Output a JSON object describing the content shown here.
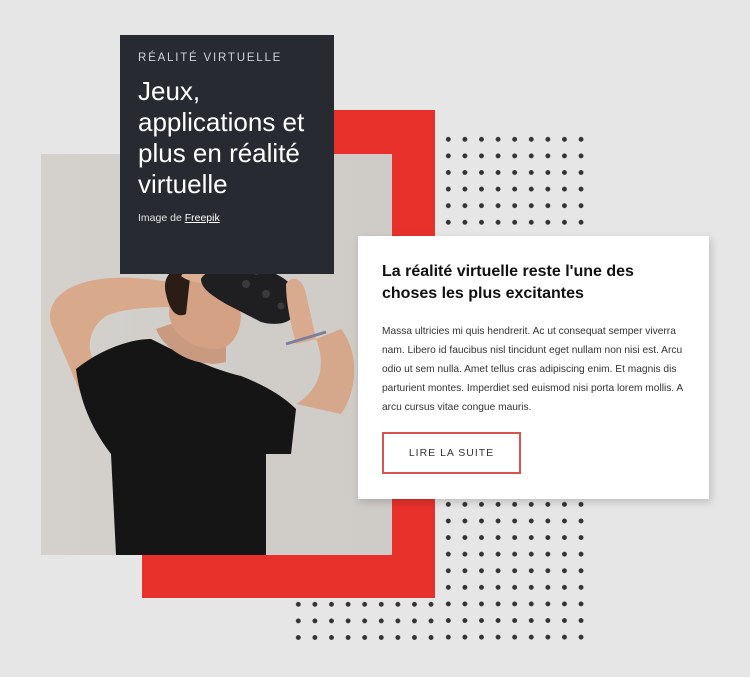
{
  "hero": {
    "eyebrow": "RÉALITÉ VIRTUELLE",
    "title": "Jeux, applications et plus en réalité virtuelle",
    "credit_prefix": "Image de ",
    "credit_link": "Freepik",
    "photo_subject": "man wearing VR headset in black t-shirt"
  },
  "card": {
    "heading": "La réalité virtuelle reste l'une des choses les plus excitantes",
    "body": "Massa ultricies mi quis hendrerit. Ac ut consequat semper viverra nam. Libero id faucibus nisl tincidunt eget nullam non nisi est. Arcu odio ut sem nulla. Amet tellus cras adipiscing enim. Et magnis dis parturient montes. Imperdiet sed euismod nisi porta lorem mollis. A arcu cursus vitae congue mauris.",
    "button_label": "LIRE LA SUITE"
  },
  "colors": {
    "accent_red": "#e8312a",
    "dark_panel": "#272a31",
    "button_border": "#d9534f",
    "background": "#e6e6e6"
  }
}
